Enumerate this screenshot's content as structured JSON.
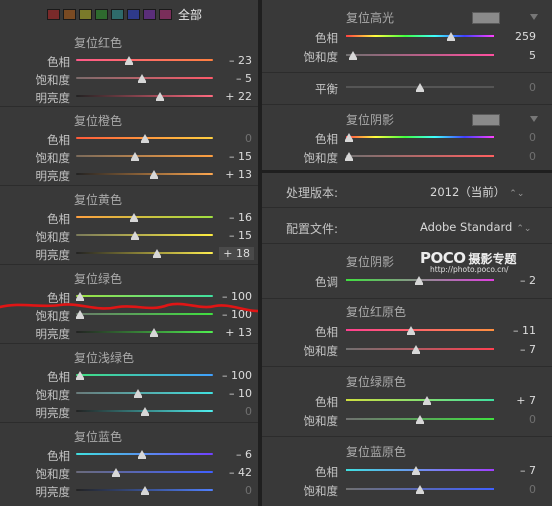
{
  "header": {
    "swatch_colors": [
      "#7a2a2a",
      "#7a4a22",
      "#7a7a2a",
      "#2e6a2e",
      "#2e6a6a",
      "#2e3a8a",
      "#5a2e7a",
      "#7a2e5a"
    ],
    "all_label": "全部"
  },
  "left_sections": [
    {
      "title": "复位红色",
      "rows": [
        {
          "label": "色相",
          "value": "– 23",
          "pos": 0.39,
          "colors": [
            "#ff5a8a",
            "#ff8040"
          ]
        },
        {
          "label": "饱和度",
          "value": "– 5",
          "pos": 0.48,
          "colors": [
            "#7a6a6a",
            "#ff5a6a"
          ]
        },
        {
          "label": "明亮度",
          "value": "+ 22",
          "pos": 0.61,
          "colors": [
            "#222222",
            "#ff6a80"
          ]
        }
      ]
    },
    {
      "title": "复位橙色",
      "rows": [
        {
          "label": "色相",
          "value": "0",
          "pos": 0.5,
          "colors": [
            "#ff5a3a",
            "#ffd040"
          ]
        },
        {
          "label": "饱和度",
          "value": "– 15",
          "pos": 0.43,
          "colors": [
            "#7a6a5a",
            "#ffa040"
          ]
        },
        {
          "label": "明亮度",
          "value": "+ 13",
          "pos": 0.57,
          "colors": [
            "#222222",
            "#ffa850"
          ]
        }
      ]
    },
    {
      "title": "复位黄色",
      "rows": [
        {
          "label": "色相",
          "value": "– 16",
          "pos": 0.42,
          "colors": [
            "#ffa040",
            "#a0e040"
          ]
        },
        {
          "label": "饱和度",
          "value": "– 15",
          "pos": 0.43,
          "colors": [
            "#7a7a5a",
            "#ffee40"
          ]
        },
        {
          "label": "明亮度",
          "value": "+ 18",
          "pos": 0.59,
          "colors": [
            "#222222",
            "#ffee50"
          ],
          "active": true
        }
      ]
    },
    {
      "title": "复位绿色",
      "rows": [
        {
          "label": "色相",
          "value": "– 100",
          "pos": 0.03,
          "colors": [
            "#a0e040",
            "#40e0a0"
          ]
        },
        {
          "label": "饱和度",
          "value": "– 100",
          "pos": 0.03,
          "colors": [
            "#6a7a6a",
            "#40e040"
          ]
        },
        {
          "label": "明亮度",
          "value": "+ 13",
          "pos": 0.57,
          "colors": [
            "#222222",
            "#50f050"
          ]
        }
      ]
    },
    {
      "title": "复位浅绿色",
      "rows": [
        {
          "label": "色相",
          "value": "– 100",
          "pos": 0.03,
          "colors": [
            "#40e080",
            "#40a0ff"
          ]
        },
        {
          "label": "饱和度",
          "value": "– 10",
          "pos": 0.45,
          "colors": [
            "#6a7a7a",
            "#40e0e0"
          ]
        },
        {
          "label": "明亮度",
          "value": "0",
          "pos": 0.5,
          "colors": [
            "#222222",
            "#50f0f0"
          ]
        }
      ]
    },
    {
      "title": "复位蓝色",
      "rows": [
        {
          "label": "色相",
          "value": "– 6",
          "pos": 0.48,
          "colors": [
            "#40e0e0",
            "#7040ff"
          ]
        },
        {
          "label": "饱和度",
          "value": "– 42",
          "pos": 0.29,
          "colors": [
            "#6a6a7a",
            "#4060ff"
          ]
        },
        {
          "label": "明亮度",
          "value": "0",
          "pos": 0.5,
          "colors": [
            "#222222",
            "#5080ff"
          ]
        }
      ]
    }
  ],
  "highlight": {
    "title": "复位高光",
    "rows": [
      {
        "label": "色相",
        "value": "259",
        "pos": 0.71,
        "colors": [
          "#ff4040",
          "#ffff40",
          "#40ff40",
          "#40ffff",
          "#4040ff",
          "#ff40ff"
        ]
      },
      {
        "label": "饱和度",
        "value": "5",
        "pos": 0.05,
        "colors": [
          "#707070",
          "#ff50a0"
        ]
      }
    ]
  },
  "balance": {
    "label": "平衡",
    "value": "0",
    "pos": 0.5,
    "colors": [
      "#555555",
      "#555555"
    ]
  },
  "shadow": {
    "title": "复位阴影",
    "rows": [
      {
        "label": "色相",
        "value": "0",
        "pos": 0.02,
        "colors": [
          "#ff4040",
          "#ffff40",
          "#40ff40",
          "#40ffff",
          "#4040ff",
          "#ff40ff"
        ]
      },
      {
        "label": "饱和度",
        "value": "0",
        "pos": 0.02,
        "colors": [
          "#707070",
          "#ff6060"
        ]
      }
    ]
  },
  "process": {
    "label": "处理版本:",
    "value": "2012（当前）",
    "arrows": "⌃⌄"
  },
  "profile": {
    "label": "配置文件:",
    "value": "Adobe Standard",
    "arrows": "⌃⌄"
  },
  "watermark": {
    "logo": "POCO",
    "cn": "摄影专题",
    "url": "http://photo.poco.cn/"
  },
  "calib_shadow": {
    "title": "复位阴影",
    "rows": [
      {
        "label": "色调",
        "value": "– 2",
        "pos": 0.49,
        "colors": [
          "#40e040",
          "#e040e0"
        ]
      }
    ]
  },
  "calib_red": {
    "title": "复位红原色",
    "rows": [
      {
        "label": "色相",
        "value": "– 11",
        "pos": 0.44,
        "colors": [
          "#ff4090",
          "#ff9040"
        ]
      },
      {
        "label": "饱和度",
        "value": "– 7",
        "pos": 0.47,
        "colors": [
          "#707070",
          "#ff4050"
        ]
      }
    ]
  },
  "calib_green": {
    "title": "复位绿原色",
    "rows": [
      {
        "label": "色相",
        "value": "+ 7",
        "pos": 0.55,
        "colors": [
          "#d0e040",
          "#40e0a0"
        ]
      },
      {
        "label": "饱和度",
        "value": "0",
        "pos": 0.5,
        "colors": [
          "#707070",
          "#40e040"
        ]
      }
    ]
  },
  "calib_blue": {
    "title": "复位蓝原色",
    "rows": [
      {
        "label": "色相",
        "value": "– 7",
        "pos": 0.47,
        "colors": [
          "#40e0e0",
          "#a040ff"
        ]
      },
      {
        "label": "饱和度",
        "value": "0",
        "pos": 0.5,
        "colors": [
          "#707070",
          "#4060ff"
        ]
      }
    ]
  }
}
